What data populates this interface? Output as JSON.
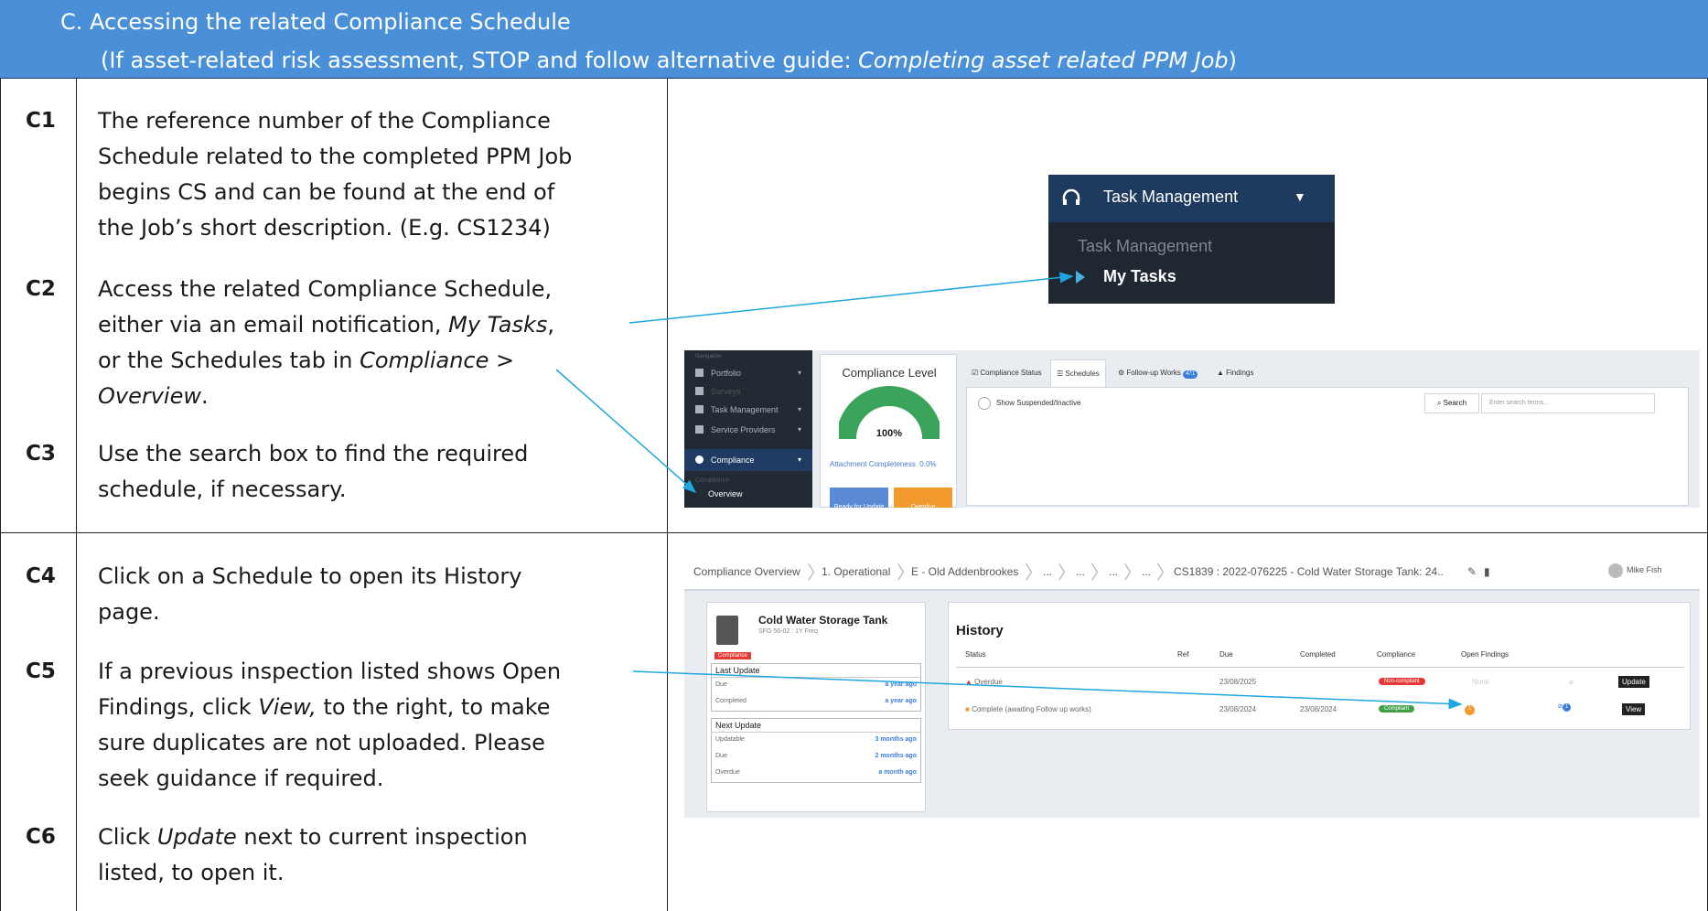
{
  "header": {
    "line1": "C.  Accessing the related Compliance Schedule",
    "line2_a": "(If asset-related risk assessment, STOP and follow alternative guide: ",
    "line2_em": "Completing asset related PPM Job",
    "line2_b": ")"
  },
  "steps": [
    {
      "id": "C1",
      "lines": [
        "The reference number of the Compliance",
        "Schedule related to the completed PPM Job",
        "begins CS and can be found at the end of",
        "the Job’s short description. (E.g. CS1234)"
      ]
    },
    {
      "id": "C2",
      "l1": "Access the related Compliance Schedule,",
      "l2a": "either via an email notification, ",
      "l2em": "My Tasks",
      "l2b": ",",
      "l3a": "or the Schedules tab in ",
      "l3em": "Compliance",
      "l3b": " >",
      "l4em": "Overview",
      "l4b": "."
    },
    {
      "id": "C3",
      "lines": [
        "Use the search box to find the required",
        "schedule, if necessary."
      ]
    },
    {
      "id": "C4",
      "lines": [
        "Click on a Schedule to open its History",
        "page."
      ]
    },
    {
      "id": "C5",
      "l1": "If a previous inspection listed shows Open",
      "l2a": "Findings, click ",
      "l2em": "View,",
      "l2b": " to the right, to make",
      "l3": "sure duplicates are not uploaded. Please",
      "l4": "seek guidance if required."
    },
    {
      "id": "C6",
      "l1a": "Click ",
      "l1em": "Update",
      "l1b": " next to current inspection",
      "l2": "listed, to open it."
    }
  ],
  "task_menu": {
    "title": "Task Management",
    "sub": "Task Management",
    "my_tasks": "My Tasks"
  },
  "compliance_screen": {
    "nav_header": "Navigation",
    "nav": [
      "Portfolio",
      "Surveys",
      "Task Management",
      "Service Providers",
      "Compliance"
    ],
    "nav_sub_header": "Compliance",
    "nav_sub": "Overview",
    "level_title": "Compliance Level",
    "level_pct": "100%",
    "attachment": "Attachment Completeness",
    "attachment_pct": "0.0%",
    "btn_ready": "Ready for Update",
    "btn_overdue": "Overdue",
    "tabs": [
      "Compliance Status",
      "Schedules",
      "Follow-up Works",
      "Findings"
    ],
    "followup_count": "471",
    "show_suspended": "Show Suspended/Inactive",
    "search_btn": "Search",
    "search_placeholder": "Enter search terms..."
  },
  "history_screen": {
    "crumbs": [
      "Compliance Overview",
      "1. Operational",
      "E - Old Addenbrookes",
      "...",
      "...",
      "...",
      "...",
      "CS1839 : 2022-076225 - Cold Water Storage Tank: 24.."
    ],
    "user": "Mike Fish",
    "card_title": "Cold Water Storage Tank",
    "card_sub": "SFG 56-02 : 1Y Freq",
    "card_tag": "Compliance",
    "last_update": "Last Update",
    "last_rows": [
      {
        "k": "Due",
        "v": "a year ago"
      },
      {
        "k": "Completed",
        "v": "a year ago"
      }
    ],
    "next_update": "Next Update",
    "next_rows": [
      {
        "k": "Updatable",
        "v": "3 months ago"
      },
      {
        "k": "Due",
        "v": "2 months ago"
      },
      {
        "k": "Overdue",
        "v": "a month ago"
      }
    ],
    "history_title": "History",
    "columns": [
      "Status",
      "Ref",
      "Due",
      "Completed",
      "Compliance",
      "Open Findings"
    ],
    "rows": [
      {
        "status": "Overdue",
        "due": "23/08/2025",
        "completed": "",
        "compliance": "Non-compliant",
        "findings": "None",
        "action": "Update"
      },
      {
        "status": "Complete (awaiting Follow up works)",
        "due": "23/08/2024",
        "completed": "23/08/2024",
        "compliance": "Compliant",
        "findings": "1",
        "attach": "1",
        "action": "View"
      }
    ]
  },
  "colors": {
    "header": "#4a90d9",
    "arrow": "#1fa6e0"
  }
}
